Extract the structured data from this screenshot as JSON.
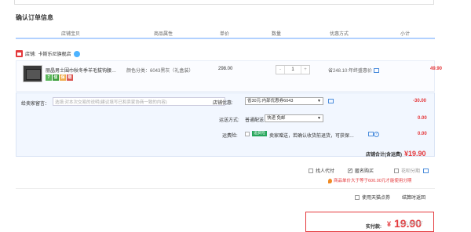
{
  "page": {
    "title": "确认订单信息"
  },
  "table_headers": [
    "店铺宝贝",
    "商品属性",
    "单价",
    "数量",
    "优惠方式",
    "小计"
  ],
  "shop": {
    "prefix": "店铺:",
    "name": "卡斯乐尼旗舰店"
  },
  "item": {
    "title": "丽晶男士围巾秋冬季羊毛拔钩腰…",
    "badges": [
      "7",
      "信",
      "保",
      "赔"
    ],
    "attributes": "颜色分类：6043黑灰（礼盒装）",
    "price": "298.00",
    "quantity": "1",
    "qty_minus": "-",
    "qty_plus": "+",
    "discount": "省248.10:年终盛惠价",
    "subtotal": "49.90"
  },
  "message": {
    "label": "给卖家留言：",
    "placeholder": "选填:对本次交易的说明(建议填写已和卖家协商一致的内容)"
  },
  "store_coupon": {
    "label": "店铺优惠:",
    "value": "省30元:内部优惠券6043",
    "amount": "-30.00"
  },
  "shipping": {
    "label": "运送方式:",
    "method": "普通配送",
    "value": "快递 免邮",
    "amount": "0.00"
  },
  "insurance": {
    "label": "运费险:",
    "badge": "运费险",
    "text": "卖家赠送，若确认收货前退货，可获保…",
    "amount": "0.00"
  },
  "shop_total": {
    "label": "店铺合计(含运费)",
    "currency": "¥",
    "amount": "19.90"
  },
  "options": {
    "anonymous": "找人代付",
    "anonymous_buy": "匿名购买",
    "installment": "花呗分期"
  },
  "installment_note": "商品单价大于等于600.00元才能使用分期",
  "store_pickup": "使用天猫点券",
  "cart_link": "结算时返回",
  "payable": {
    "label": "实付款:",
    "currency": "¥",
    "amount": "19.90"
  },
  "watermark": "什么值得买"
}
